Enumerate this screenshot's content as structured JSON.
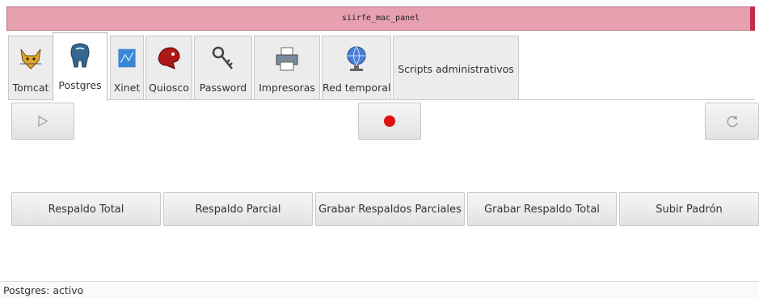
{
  "window": {
    "title": "siirfe_mac_panel"
  },
  "tabs": [
    {
      "label": "Tomcat",
      "icon": "tomcat-icon"
    },
    {
      "label": "Postgres",
      "icon": "postgres-elephant-icon",
      "active": true
    },
    {
      "label": "Xinet",
      "icon": "xinet-icon"
    },
    {
      "label": "Quiosco",
      "icon": "quiosco-icon"
    },
    {
      "label": "Password",
      "icon": "keys-icon"
    },
    {
      "label": "Impresoras",
      "icon": "printer-icon"
    },
    {
      "label": "Red temporal",
      "icon": "network-globe-icon"
    },
    {
      "label": "Scripts administrativos"
    }
  ],
  "toolbar": {
    "start_icon": "play-icon",
    "stop_icon": "record-stop-icon",
    "refresh_icon": "refresh-icon",
    "stop_color": "#e01010"
  },
  "actions": [
    "Respaldo Total",
    "Respaldo Parcial",
    "Grabar Respaldos Parciales",
    "Grabar Respaldo Total",
    "Subir Padrón"
  ],
  "status": {
    "text": "Postgres: activo"
  }
}
